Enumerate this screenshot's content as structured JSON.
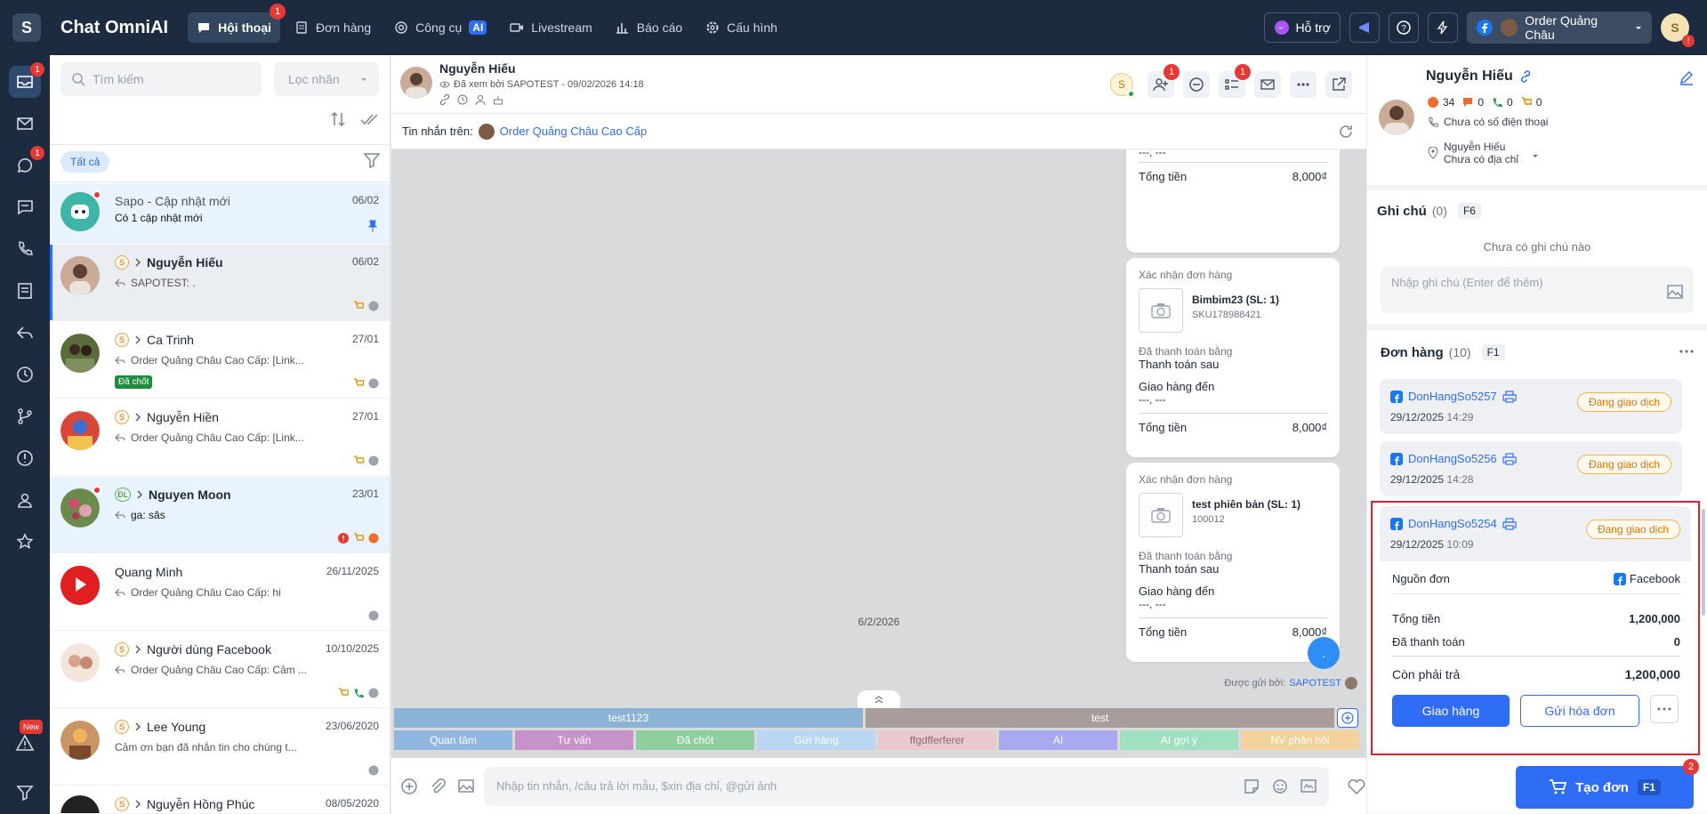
{
  "app": {
    "logo": "S",
    "title": "Chat OmniAI"
  },
  "nav": [
    {
      "label": "Hội thoại",
      "badge": "1",
      "icon": "chat-icon"
    },
    {
      "label": "Đơn hàng",
      "icon": "order-icon"
    },
    {
      "label": "Công cụ",
      "ai": "AI",
      "icon": "tools-icon"
    },
    {
      "label": "Livestream",
      "icon": "video-icon"
    },
    {
      "label": "Báo cáo",
      "icon": "chart-icon"
    },
    {
      "label": "Cấu hình",
      "icon": "settings-icon"
    }
  ],
  "topright": {
    "support": "Hỗ trợ",
    "page": "Order Quảng Châu",
    "user_initial": "S",
    "user_badge": "!"
  },
  "rail": {
    "inbox_badge": "1",
    "comment_badge": "1",
    "new_badge": "New"
  },
  "convlist": {
    "search_placeholder": "Tìm kiếm",
    "label_filter": "Lọc nhãn",
    "chip_all": "Tất cả",
    "items": [
      {
        "name": "Sapo - Cập nhật mới",
        "date": "06/02",
        "preview": "Có 1 cập nhật mới"
      },
      {
        "name": "Nguyễn Hiếu",
        "date": "06/02",
        "preview": "SAPOTEST: ."
      },
      {
        "name": "Ca Trinh",
        "date": "27/01",
        "preview": "Order Quảng Châu Cao Cấp: [Link...",
        "tag": "Đã chốt"
      },
      {
        "name": "Nguyễn Hiền",
        "date": "27/01",
        "preview": "Order Quảng Châu Cao Cấp: [Link..."
      },
      {
        "name": "Nguyen Moon",
        "date": "23/01",
        "preview": "ga: sâs",
        "label": "ĐL"
      },
      {
        "name": "Quang Minh",
        "date": "26/11/2025",
        "preview": "Order Quảng Châu Cao Cấp: hi",
        "avatar_text": "YouTube"
      },
      {
        "name": "Người dùng Facebook",
        "date": "10/10/2025",
        "preview": "Order Quảng Châu Cao Cấp: Cảm ..."
      },
      {
        "name": "Lee Young",
        "date": "23/06/2020",
        "preview": "Cảm ơn bạn đã nhắn tin cho chúng t..."
      },
      {
        "name": "Nguyễn Hồng Phúc",
        "date": "08/05/2020",
        "preview": ""
      }
    ]
  },
  "chat": {
    "name": "Nguyễn Hiếu",
    "seen": "Đã xem bởi SAPOTEST - 09/02/2026 14:18",
    "header_initial": "S",
    "add_badge": "1",
    "list_badge": "1",
    "sub_label": "Tin nhắn trên:",
    "sub_page": "Order Quảng Châu Cao Cấp",
    "cards": [
      {
        "addr": "---, ---",
        "total_label": "Tổng tiền",
        "total": "8,000₫"
      },
      {
        "title": "Xác nhận đơn hàng",
        "product": "Bimbim23 (SL: 1)",
        "sku": "SKU178988421",
        "paid_label": "Đã thanh toán bằng",
        "paid": "Thanh toán sau",
        "ship_label": "Giao hàng đến",
        "addr": "---, ---",
        "total_label": "Tổng tiền",
        "total": "8,000₫"
      },
      {
        "title": "Xác nhận đơn hàng",
        "product": "test phiên bản (SL: 1)",
        "sku": "100012",
        "paid_label": "Đã thanh toán bằng",
        "paid": "Thanh toán sau",
        "ship_label": "Giao hàng đến",
        "addr": "---, ---",
        "total_label": "Tổng tiền",
        "total": "8,000₫"
      }
    ],
    "date_sep": "6/2/2026",
    "msg": ".",
    "sent_by": "Được gửi bởi:",
    "sent_by_name": "SAPOTEST",
    "tag_groups": [
      "test1123",
      "test"
    ],
    "tags": [
      "Quan tâm",
      "Tư vấn",
      "Đã chốt",
      "Gửi hàng",
      "ffgdfferferer",
      "AI",
      "AI gợi ý",
      "NV phản hồi"
    ],
    "composer_placeholder": "Nhập tin nhắn, /câu trả lời mẫu, $xin địa chỉ, @gửi ảnh"
  },
  "customer": {
    "name": "Nguyễn Hiếu",
    "stats": {
      "msgs": "34",
      "comments": "0",
      "calls": "0",
      "orders": "0"
    },
    "phone": "Chưa có số điện thoại",
    "addr_name": "Nguyễn Hiếu",
    "addr": "Chưa có địa chỉ"
  },
  "notes": {
    "title": "Ghi chú",
    "count": "(0)",
    "key": "F6",
    "empty": "Chưa có ghi chú nào",
    "placeholder": "Nhập ghi chú (Enter để thêm)"
  },
  "orders": {
    "title": "Đơn hàng",
    "count": "(10)",
    "key": "F1",
    "items": [
      {
        "id": "DonHangSo5257",
        "date": "29/12/2025",
        "time": "14:29",
        "status": "Đang giao dịch"
      },
      {
        "id": "DonHangSo5256",
        "date": "29/12/2025",
        "time": "14:28",
        "status": "Đang giao dịch"
      },
      {
        "id": "DonHangSo5254",
        "date": "29/12/2025",
        "time": "10:09",
        "status": "Đang giao dịch"
      }
    ],
    "detail": {
      "source_label": "Nguồn đơn",
      "source": "Facebook",
      "total_label": "Tổng tiền",
      "total": "1,200,000",
      "paid_label": "Đã thanh toán",
      "paid": "0",
      "remain_label": "Còn phải trả",
      "remain": "1,200,000",
      "ship_btn": "Giao hàng",
      "invoice_btn": "Gửi hóa đơn"
    },
    "create_btn": "Tạo đơn",
    "create_key": "F1",
    "create_badge": "2"
  },
  "colors": {
    "brand": "#2f6df6",
    "topbar": "#1c2b40",
    "highlight": "#e11d2e"
  }
}
